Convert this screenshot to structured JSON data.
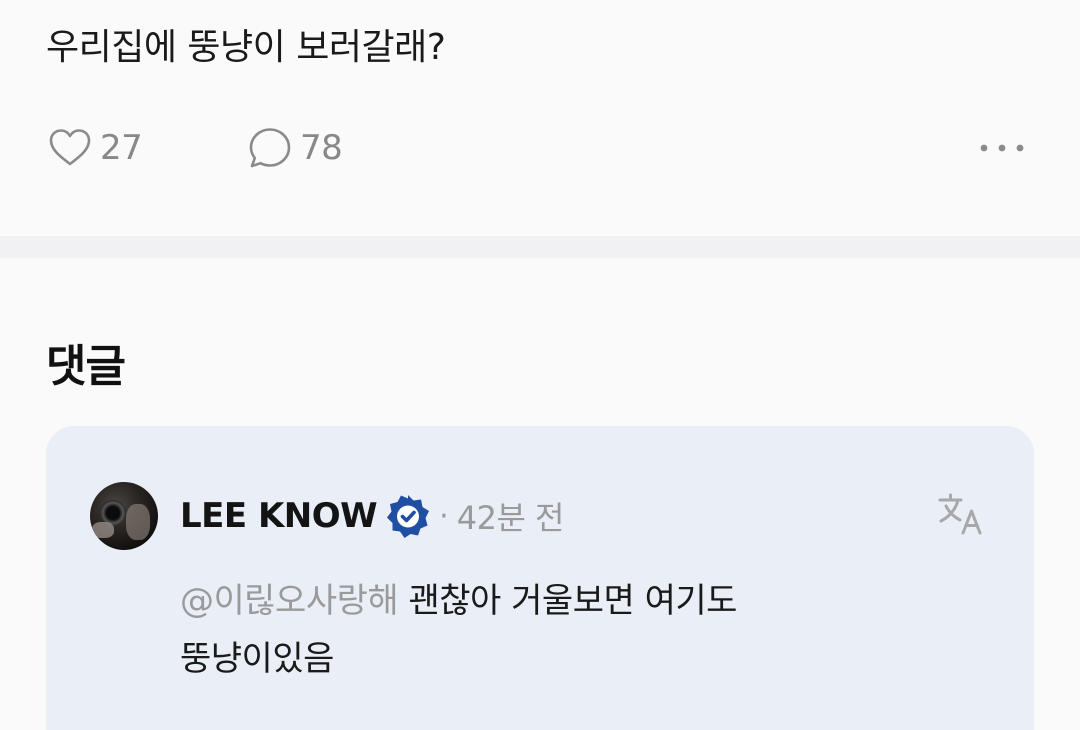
{
  "post": {
    "text": "우리집에 뚱냥이 보러갈래?",
    "like_count": "27",
    "comment_count": "78",
    "icons": {
      "like": "heart-outline-icon",
      "comment": "speech-bubble-icon",
      "more": "more-horizontal-icon"
    }
  },
  "comments": {
    "heading": "댓글",
    "items": [
      {
        "author": "LEE KNOW",
        "verified": true,
        "separator": "·",
        "time": "42분 전",
        "mention": "@이릲오사랑해",
        "text_line1": "괜찮아 거울보면 여기도",
        "text_line2": "뚱냥이있음",
        "icons": {
          "verified": "verified-badge-icon",
          "translate": "translate-icon"
        }
      }
    ]
  },
  "colors": {
    "background": "#fafafa",
    "divider": "#f1f1f3",
    "comment_card": "#e9eef7",
    "muted_text": "#9a9a9a",
    "verified_badge": "#1f4ea3"
  }
}
